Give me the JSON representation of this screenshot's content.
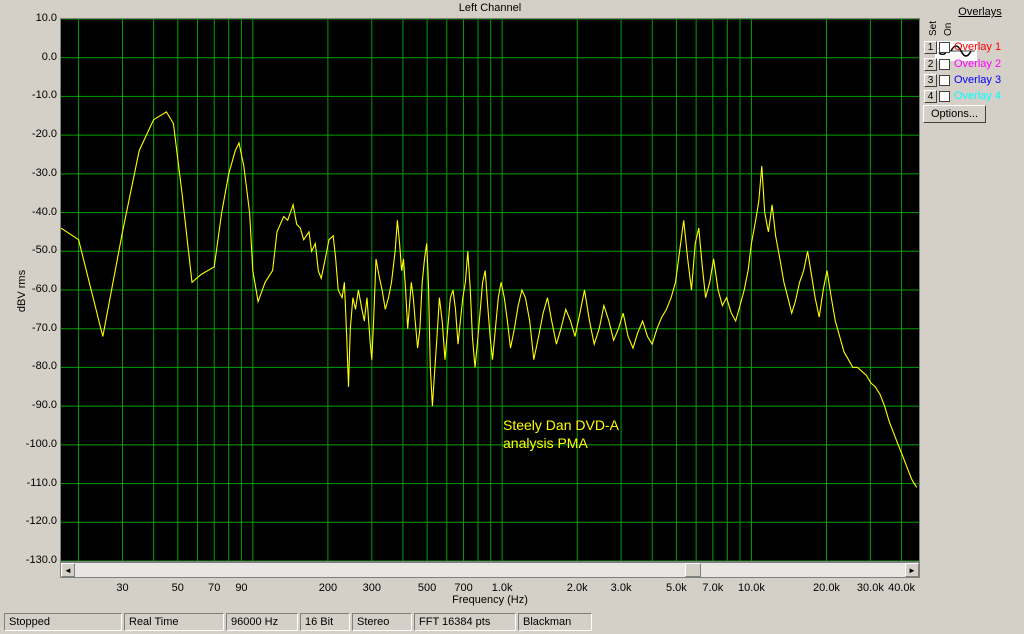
{
  "chart_data": {
    "type": "line",
    "title": "Left Channel",
    "xlabel": "Frequency (Hz)",
    "ylabel": "dBV rms",
    "xscale": "log",
    "xlim": [
      17,
      47000
    ],
    "ylim": [
      -130,
      10
    ],
    "grid": true,
    "line_color": "#ffff00",
    "grid_color": "#00a000",
    "y_ticks": [
      "10.0",
      "0.0",
      "-10.0",
      "-20.0",
      "-30.0",
      "-40.0",
      "-50.0",
      "-60.0",
      "-70.0",
      "-80.0",
      "-90.0",
      "-100.0",
      "-110.0",
      "-120.0",
      "-130.0"
    ],
    "x_ticks": [
      {
        "v": 30,
        "label": "30"
      },
      {
        "v": 50,
        "label": "50"
      },
      {
        "v": 70,
        "label": "70"
      },
      {
        "v": 90,
        "label": "90"
      },
      {
        "v": 200,
        "label": "200"
      },
      {
        "v": 300,
        "label": "300"
      },
      {
        "v": 500,
        "label": "500"
      },
      {
        "v": 700,
        "label": "700"
      },
      {
        "v": 1000,
        "label": "1.0k"
      },
      {
        "v": 2000,
        "label": "2.0k"
      },
      {
        "v": 3000,
        "label": "3.0k"
      },
      {
        "v": 5000,
        "label": "5.0k"
      },
      {
        "v": 7000,
        "label": "7.0k"
      },
      {
        "v": 10000,
        "label": "10.0k"
      },
      {
        "v": 20000,
        "label": "20.0k"
      },
      {
        "v": 30000,
        "label": "30.0k"
      },
      {
        "v": 40000,
        "label": "40.0k"
      }
    ],
    "x_grid": [
      20,
      30,
      40,
      50,
      60,
      70,
      80,
      90,
      100,
      200,
      300,
      400,
      500,
      600,
      700,
      800,
      900,
      1000,
      2000,
      3000,
      4000,
      5000,
      6000,
      7000,
      8000,
      9000,
      10000,
      20000,
      30000,
      40000
    ],
    "annotation": [
      "Steely Dan DVD-A",
      "analysis PMA"
    ],
    "series": [
      {
        "points": [
          [
            17,
            -44
          ],
          [
            20,
            -47
          ],
          [
            25,
            -72
          ],
          [
            30,
            -45
          ],
          [
            35,
            -24
          ],
          [
            40,
            -16
          ],
          [
            45,
            -14
          ],
          [
            48,
            -17
          ],
          [
            52,
            -35
          ],
          [
            57,
            -58
          ],
          [
            62,
            -56
          ],
          [
            70,
            -54
          ],
          [
            75,
            -40
          ],
          [
            80,
            -30
          ],
          [
            85,
            -24
          ],
          [
            88,
            -22
          ],
          [
            92,
            -28
          ],
          [
            97,
            -40
          ],
          [
            100,
            -55
          ],
          [
            105,
            -63
          ],
          [
            112,
            -58
          ],
          [
            120,
            -55
          ],
          [
            125,
            -45
          ],
          [
            133,
            -41
          ],
          [
            138,
            -42
          ],
          [
            145,
            -38
          ],
          [
            150,
            -43
          ],
          [
            155,
            -44
          ],
          [
            160,
            -47
          ],
          [
            168,
            -45
          ],
          [
            172,
            -50
          ],
          [
            178,
            -48
          ],
          [
            183,
            -55
          ],
          [
            188,
            -57
          ],
          [
            195,
            -52
          ],
          [
            202,
            -47
          ],
          [
            210,
            -46
          ],
          [
            215,
            -52
          ],
          [
            220,
            -60
          ],
          [
            228,
            -62
          ],
          [
            233,
            -58
          ],
          [
            238,
            -72
          ],
          [
            242,
            -85
          ],
          [
            246,
            -70
          ],
          [
            252,
            -62
          ],
          [
            258,
            -65
          ],
          [
            265,
            -60
          ],
          [
            272,
            -64
          ],
          [
            280,
            -68
          ],
          [
            287,
            -62
          ],
          [
            295,
            -73
          ],
          [
            300,
            -78
          ],
          [
            305,
            -68
          ],
          [
            312,
            -52
          ],
          [
            320,
            -56
          ],
          [
            330,
            -60
          ],
          [
            340,
            -65
          ],
          [
            350,
            -62
          ],
          [
            360,
            -58
          ],
          [
            372,
            -50
          ],
          [
            380,
            -42
          ],
          [
            388,
            -48
          ],
          [
            395,
            -55
          ],
          [
            402,
            -52
          ],
          [
            410,
            -60
          ],
          [
            418,
            -70
          ],
          [
            425,
            -64
          ],
          [
            432,
            -58
          ],
          [
            440,
            -62
          ],
          [
            448,
            -68
          ],
          [
            458,
            -75
          ],
          [
            468,
            -70
          ],
          [
            478,
            -58
          ],
          [
            488,
            -52
          ],
          [
            498,
            -48
          ],
          [
            506,
            -58
          ],
          [
            515,
            -80
          ],
          [
            525,
            -90
          ],
          [
            535,
            -82
          ],
          [
            548,
            -72
          ],
          [
            560,
            -62
          ],
          [
            575,
            -68
          ],
          [
            590,
            -78
          ],
          [
            605,
            -70
          ],
          [
            620,
            -62
          ],
          [
            635,
            -60
          ],
          [
            650,
            -65
          ],
          [
            665,
            -74
          ],
          [
            680,
            -68
          ],
          [
            695,
            -62
          ],
          [
            712,
            -58
          ],
          [
            728,
            -50
          ],
          [
            745,
            -60
          ],
          [
            760,
            -72
          ],
          [
            778,
            -80
          ],
          [
            795,
            -74
          ],
          [
            815,
            -66
          ],
          [
            835,
            -58
          ],
          [
            855,
            -55
          ],
          [
            875,
            -64
          ],
          [
            895,
            -72
          ],
          [
            915,
            -78
          ],
          [
            940,
            -70
          ],
          [
            965,
            -62
          ],
          [
            990,
            -58
          ],
          [
            1020,
            -62
          ],
          [
            1050,
            -68
          ],
          [
            1080,
            -75
          ],
          [
            1120,
            -70
          ],
          [
            1160,
            -64
          ],
          [
            1200,
            -60
          ],
          [
            1240,
            -62
          ],
          [
            1290,
            -68
          ],
          [
            1340,
            -78
          ],
          [
            1400,
            -72
          ],
          [
            1460,
            -66
          ],
          [
            1520,
            -62
          ],
          [
            1580,
            -68
          ],
          [
            1650,
            -74
          ],
          [
            1720,
            -70
          ],
          [
            1800,
            -65
          ],
          [
            1880,
            -68
          ],
          [
            1960,
            -72
          ],
          [
            2050,
            -66
          ],
          [
            2140,
            -60
          ],
          [
            2240,
            -68
          ],
          [
            2340,
            -74
          ],
          [
            2450,
            -70
          ],
          [
            2560,
            -64
          ],
          [
            2680,
            -68
          ],
          [
            2800,
            -73
          ],
          [
            2930,
            -70
          ],
          [
            3060,
            -66
          ],
          [
            3200,
            -72
          ],
          [
            3350,
            -75
          ],
          [
            3500,
            -71
          ],
          [
            3660,
            -68
          ],
          [
            3830,
            -72
          ],
          [
            4000,
            -74
          ],
          [
            4180,
            -70
          ],
          [
            4370,
            -67
          ],
          [
            4560,
            -65
          ],
          [
            4760,
            -62
          ],
          [
            4960,
            -58
          ],
          [
            5150,
            -50
          ],
          [
            5350,
            -42
          ],
          [
            5550,
            -52
          ],
          [
            5750,
            -60
          ],
          [
            5950,
            -48
          ],
          [
            6150,
            -44
          ],
          [
            6350,
            -54
          ],
          [
            6550,
            -62
          ],
          [
            6800,
            -58
          ],
          [
            7050,
            -52
          ],
          [
            7350,
            -60
          ],
          [
            7650,
            -64
          ],
          [
            7950,
            -62
          ],
          [
            8300,
            -66
          ],
          [
            8650,
            -68
          ],
          [
            9000,
            -64
          ],
          [
            9350,
            -60
          ],
          [
            9700,
            -55
          ],
          [
            10000,
            -48
          ],
          [
            10400,
            -42
          ],
          [
            10700,
            -37
          ],
          [
            11000,
            -28
          ],
          [
            11300,
            -40
          ],
          [
            11700,
            -45
          ],
          [
            12100,
            -38
          ],
          [
            12500,
            -46
          ],
          [
            13000,
            -52
          ],
          [
            13500,
            -58
          ],
          [
            14000,
            -62
          ],
          [
            14500,
            -66
          ],
          [
            15000,
            -63
          ],
          [
            15600,
            -58
          ],
          [
            16200,
            -55
          ],
          [
            16800,
            -50
          ],
          [
            17400,
            -56
          ],
          [
            18000,
            -62
          ],
          [
            18700,
            -67
          ],
          [
            19400,
            -60
          ],
          [
            20100,
            -55
          ],
          [
            20900,
            -62
          ],
          [
            21700,
            -68
          ],
          [
            22600,
            -72
          ],
          [
            23500,
            -76
          ],
          [
            24500,
            -78
          ],
          [
            25500,
            -80
          ],
          [
            26600,
            -80
          ],
          [
            27700,
            -81
          ],
          [
            28900,
            -82
          ],
          [
            30100,
            -84
          ],
          [
            31400,
            -85
          ],
          [
            32800,
            -87
          ],
          [
            34200,
            -90
          ],
          [
            35700,
            -94
          ],
          [
            37200,
            -97
          ],
          [
            38800,
            -100
          ],
          [
            40500,
            -103
          ],
          [
            42200,
            -106
          ],
          [
            44000,
            -109
          ],
          [
            46000,
            -111
          ]
        ]
      }
    ]
  },
  "overlays": {
    "title": "Overlays",
    "col_set": "Set",
    "col_on": "On",
    "items": [
      {
        "num": "1",
        "label": "Overlay 1",
        "color": "#ff0000"
      },
      {
        "num": "2",
        "label": "Overlay 2",
        "color": "#ff00ff"
      },
      {
        "num": "3",
        "label": "Overlay 3",
        "color": "#0000ff"
      },
      {
        "num": "4",
        "label": "Overlay 4",
        "color": "#00ffff"
      }
    ],
    "options_label": "Options..."
  },
  "statusbar": {
    "cells": [
      "Stopped",
      "Real Time",
      "96000 Hz",
      "16 Bit",
      "Stereo",
      "FFT 16384 pts",
      "Blackman"
    ]
  },
  "scrollbar": {
    "left_arrow": "◄",
    "right_arrow": "►"
  }
}
